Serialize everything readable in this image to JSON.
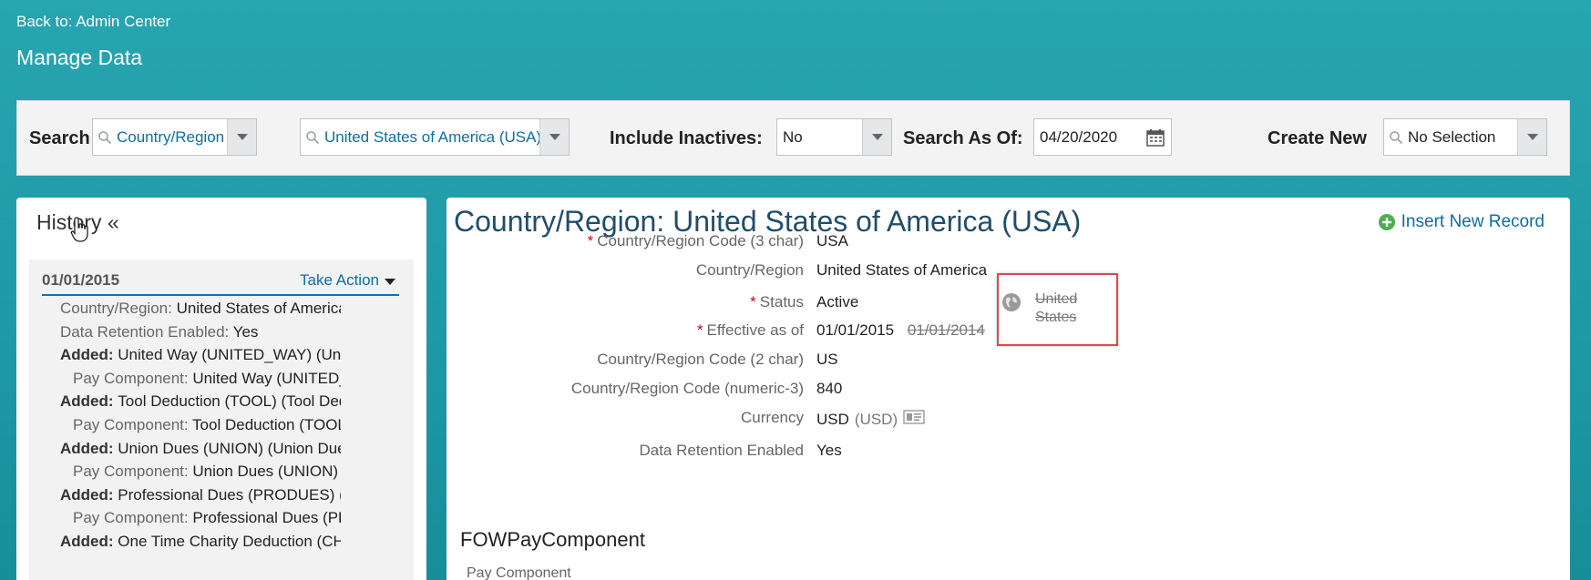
{
  "header": {
    "back_link": "Back to: Admin Center",
    "title": "Manage Data"
  },
  "search": {
    "label": "Search",
    "object_type": "Country/Region",
    "object_value": "United States of America (USA)",
    "include_inactives_label": "Include Inactives:",
    "include_inactives_value": "No",
    "search_as_of_label": "Search As Of:",
    "search_as_of_value": "04/20/2020",
    "create_new_label": "Create New",
    "create_new_value": "No Selection"
  },
  "history": {
    "title": "History «",
    "date": "01/01/2015",
    "take_action": "Take Action",
    "rows": [
      {
        "key": "Country/Region",
        "sep": ": ",
        "value": "United States of America...",
        "bold": false,
        "indent": 1
      },
      {
        "key": "Data Retention Enabled",
        "sep": ": ",
        "value": "Yes",
        "bold": false,
        "indent": 1
      },
      {
        "key": "Added",
        "sep": ": ",
        "value": "United Way (UNITED_WAY) (Unite...",
        "bold": true,
        "indent": 1
      },
      {
        "key": "Pay Component",
        "sep": ": ",
        "value": "United Way (UNITED_...",
        "bold": false,
        "indent": 2
      },
      {
        "key": "Added",
        "sep": ": ",
        "value": "Tool Deduction (TOOL) (Tool Dedu...",
        "bold": true,
        "indent": 1
      },
      {
        "key": "Pay Component",
        "sep": ": ",
        "value": "Tool Deduction (TOOL)",
        "bold": false,
        "indent": 2
      },
      {
        "key": "Added",
        "sep": ": ",
        "value": "Union Dues (UNION) (Union Dues ...",
        "bold": true,
        "indent": 1
      },
      {
        "key": "Pay Component",
        "sep": ": ",
        "value": "Union Dues (UNION)",
        "bold": false,
        "indent": 2
      },
      {
        "key": "Added",
        "sep": ": ",
        "value": "Professional Dues (PRODUES) (Pr...",
        "bold": true,
        "indent": 1
      },
      {
        "key": "Pay Component",
        "sep": ": ",
        "value": "Professional Dues (PR...",
        "bold": false,
        "indent": 2
      },
      {
        "key": "Added",
        "sep": ": ",
        "value": "One Time Charity Deduction (CHA...",
        "bold": true,
        "indent": 1
      }
    ]
  },
  "detail": {
    "title": "Country/Region: United States of America (USA)",
    "insert_new_record": "Insert New Record",
    "fields": {
      "code3_label": "Country/Region Code (3 char)",
      "code3_value": "USA",
      "name_label": "Country/Region",
      "name_value": "United States of America",
      "name_old_value": "United States",
      "status_label": "Status",
      "status_value": "Active",
      "effective_label": "Effective as of",
      "effective_value": "01/01/2015",
      "effective_old_value": "01/01/2014",
      "code2_label": "Country/Region Code (2 char)",
      "code2_value": "US",
      "numeric_label": "Country/Region Code (numeric-3)",
      "numeric_value": "840",
      "currency_label": "Currency",
      "currency_value": "USD",
      "currency_paren": "(USD)",
      "retention_label": "Data Retention Enabled",
      "retention_value": "Yes"
    },
    "required_mark": "*",
    "section_title": "FOWPayComponent",
    "section_sub_label": "Pay Component"
  },
  "colors": {
    "accent_link": "#0a6ea8",
    "required": "#d0021b",
    "highlight_border": "#e04848",
    "background": "#1e9aa6"
  }
}
